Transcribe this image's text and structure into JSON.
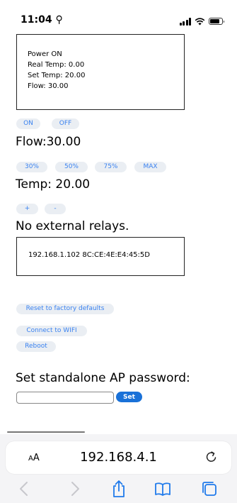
{
  "status_bar": {
    "time": "11:04 ⚲"
  },
  "status_box": {
    "lines": [
      "Power ON",
      "Real Temp: 0.00",
      "Set Temp: 20.00",
      "Flow: 30.00"
    ]
  },
  "power": {
    "on_label": "ON",
    "off_label": "OFF"
  },
  "flow": {
    "heading": "Flow:30.00",
    "buttons": [
      "30%",
      "50%",
      "75%",
      "MAX"
    ]
  },
  "temp": {
    "heading": "Temp: 20.00",
    "plus_label": "+",
    "minus_label": "-"
  },
  "relays": {
    "heading": "No external relays."
  },
  "network": {
    "info": "192.168.1.102 8C:CE:4E:E4:45:5D"
  },
  "actions": {
    "reset_label": "Reset to factory defaults",
    "wifi_label": "Connect to WIFI",
    "reboot_label": "Reboot"
  },
  "ap_password": {
    "heading": "Set standalone AP password:",
    "input_value": "",
    "set_label": "Set"
  },
  "browser": {
    "aa_label_large": "A",
    "aa_label_small": "A",
    "url": "192.168.4.1",
    "accent": "#3a82f0",
    "set_button_color": "#1971d8"
  }
}
